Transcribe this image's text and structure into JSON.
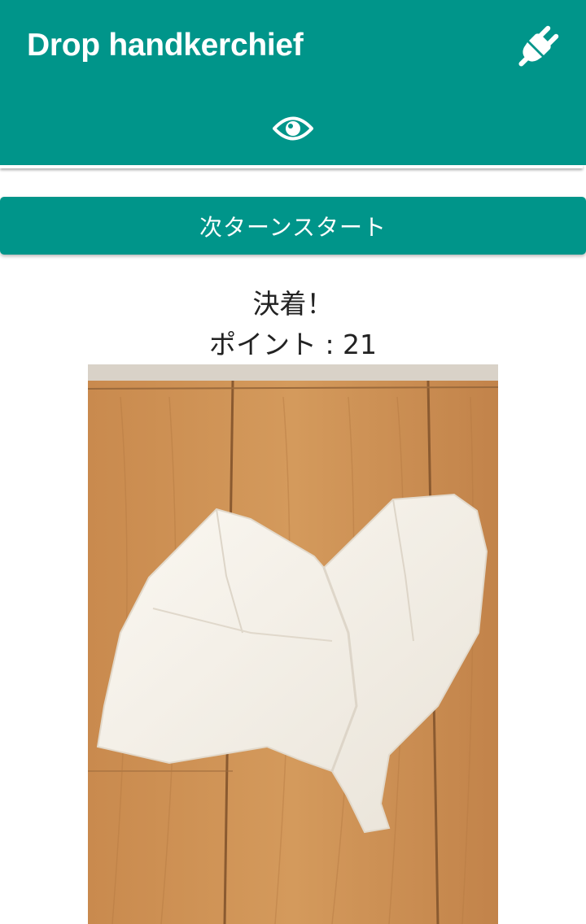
{
  "app_bar": {
    "title": "Drop handkerchief",
    "background_color": "#00958a",
    "actions": [
      {
        "icon": "plug-icon"
      }
    ],
    "tabs": [
      {
        "icon": "eye-icon",
        "selected": true
      }
    ]
  },
  "next_turn_button": {
    "label": "次ターンスタート",
    "color": "#00958a"
  },
  "result": {
    "status": "決着！",
    "points": "ポイント : 21"
  },
  "photo": {
    "icon": "handkerchief-photo"
  }
}
